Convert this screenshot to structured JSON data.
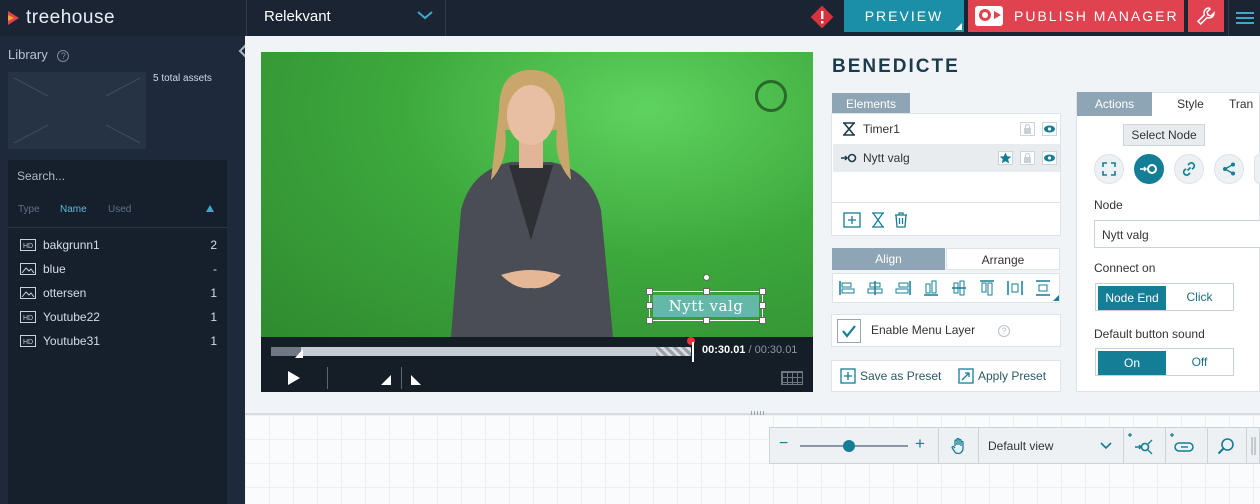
{
  "app": {
    "logo_text": "treehouse"
  },
  "topbar": {
    "project_name": "Relekvant",
    "preview_label": "PREVIEW",
    "publish_label": "PUBLISH MANAGER"
  },
  "library": {
    "title": "Library",
    "total_assets": "5 total assets",
    "search_placeholder": "Search...",
    "columns": {
      "type": "Type",
      "name": "Name",
      "used": "Used"
    },
    "assets": [
      {
        "name": "bakgrunn1",
        "used": "2",
        "icon": "hd-video-icon"
      },
      {
        "name": "blue",
        "used": "-",
        "icon": "image-icon"
      },
      {
        "name": "ottersen",
        "used": "1",
        "icon": "image-icon"
      },
      {
        "name": "Youtube22",
        "used": "1",
        "icon": "hd-video-icon"
      },
      {
        "name": "Youtube31",
        "used": "1",
        "icon": "hd-video-icon"
      }
    ]
  },
  "video": {
    "overlay_button": "Nytt valg",
    "time_current": "00:30.01",
    "time_separator": " / ",
    "time_total": "00:30.01",
    "progress_fraction": 0.92
  },
  "node": {
    "title": "BENEDICTE",
    "elements_tab": "Elements",
    "elements": [
      {
        "label": "Timer1",
        "icon": "hourglass-icon"
      },
      {
        "label": "Nytt valg",
        "icon": "node-choice-icon"
      }
    ],
    "align_tab": "Align",
    "arrange_tab": "Arrange",
    "enable_menu_layer": "Enable Menu Layer",
    "save_preset": "Save as Preset",
    "apply_preset": "Apply Preset"
  },
  "actions": {
    "tabs": [
      "Actions",
      "Style",
      "Tran"
    ],
    "tooltip": "Select Node",
    "node_label": "Node",
    "node_value": "Nytt valg",
    "connect_on_label": "Connect on",
    "connect_on_options": [
      "Node End",
      "Click"
    ],
    "sound_label": "Default button sound",
    "sound_options": [
      "On",
      "Off"
    ]
  },
  "canvas_toolbar": {
    "zoom_minus": "−",
    "zoom_plus": "+",
    "zoom_fraction": 0.45,
    "view_label": "Default view"
  },
  "colors": {
    "topbar": "#1a2433",
    "accent": "#147e97",
    "publish": "#e0424f",
    "chroma_green": "#3da93d"
  }
}
